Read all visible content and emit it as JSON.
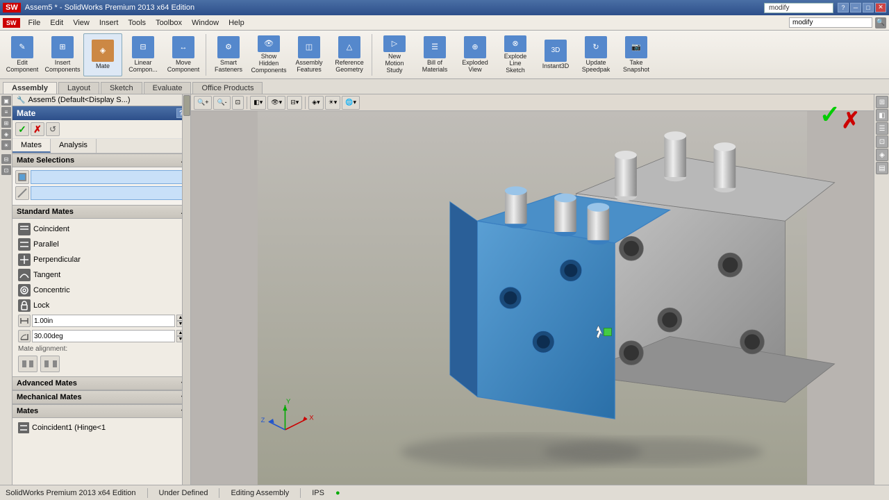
{
  "titlebar": {
    "title": "Assem5 * - SolidWorks Premium 2013 x64 Edition",
    "search_placeholder": "modify"
  },
  "menubar": {
    "items": [
      "File",
      "Edit",
      "View",
      "Insert",
      "Tools",
      "Toolbox",
      "Window",
      "Help"
    ],
    "logo": "SW"
  },
  "toolbar": {
    "buttons": [
      {
        "id": "edit-component",
        "label": "Edit\nComponent",
        "icon": "✎",
        "color": "#5588cc"
      },
      {
        "id": "insert-components",
        "label": "Insert\nComponents",
        "icon": "⊞",
        "color": "#5588cc"
      },
      {
        "id": "mate",
        "label": "Mate",
        "icon": "◈",
        "color": "#cc8844"
      },
      {
        "id": "linear-component",
        "label": "Linear\nCompon...",
        "icon": "⊟",
        "color": "#5588cc"
      },
      {
        "id": "move-component",
        "label": "Move\nComponent",
        "icon": "↔",
        "color": "#5588cc"
      },
      {
        "id": "smart-fasteners",
        "label": "Smart\nFasteners",
        "icon": "⚙",
        "color": "#5588cc"
      },
      {
        "id": "show-hidden",
        "label": "Show Hidden\nComponents",
        "icon": "👁",
        "color": "#5588cc"
      },
      {
        "id": "assembly-features",
        "label": "Assembly\nFeatures",
        "icon": "◫",
        "color": "#5588cc"
      },
      {
        "id": "reference-geometry",
        "label": "Reference\nGeometry",
        "icon": "△",
        "color": "#5588cc"
      },
      {
        "id": "new-motion-study",
        "label": "New\nMotion\nStudy",
        "icon": "▷",
        "color": "#5588cc"
      },
      {
        "id": "bill-of-materials",
        "label": "Bill of\nMaterials",
        "icon": "☰",
        "color": "#5588cc"
      },
      {
        "id": "exploded-view",
        "label": "Exploded\nView",
        "icon": "⊕",
        "color": "#5588cc"
      },
      {
        "id": "explode-line-sketch",
        "label": "Explode\nLine\nSketch",
        "icon": "⊗",
        "color": "#5588cc"
      },
      {
        "id": "instant3d",
        "label": "Instant3D",
        "icon": "3D",
        "color": "#5588cc"
      },
      {
        "id": "update-speedpak",
        "label": "Update\nSpeedpak",
        "icon": "↻",
        "color": "#5588cc"
      },
      {
        "id": "take-snapshot",
        "label": "Take\nSnapshot",
        "icon": "📷",
        "color": "#5588cc"
      }
    ]
  },
  "tabs": {
    "items": [
      "Assembly",
      "Layout",
      "Sketch",
      "Evaluate",
      "Office Products"
    ],
    "active": "Assembly"
  },
  "tree_header": {
    "text": "Assem5 (Default<Display S...)"
  },
  "mate_panel": {
    "title": "Mate",
    "help_label": "?",
    "confirm_label": "✓",
    "cancel_label": "✗",
    "reset_label": "↺",
    "tabs": [
      "Mates",
      "Analysis"
    ],
    "active_tab": "Mates",
    "selections_header": "Mate Selections",
    "selections_placeholder1": "",
    "selections_placeholder2": "",
    "standard_mates_header": "Standard Mates",
    "mates": [
      {
        "id": "coincident",
        "label": "Coincident",
        "icon": "//"
      },
      {
        "id": "parallel",
        "label": "Parallel",
        "icon": "//"
      },
      {
        "id": "perpendicular",
        "label": "Perpendicular",
        "icon": "⊥"
      },
      {
        "id": "tangent",
        "label": "Tangent",
        "icon": "⌒"
      },
      {
        "id": "concentric",
        "label": "Concentric",
        "icon": "◎"
      },
      {
        "id": "lock",
        "label": "Lock",
        "icon": "🔒"
      }
    ],
    "distance_value": "1.00in",
    "angle_value": "30.00deg",
    "alignment_label": "Mate alignment:",
    "advanced_mates_header": "Advanced Mates",
    "mechanical_mates_header": "Mechanical Mates",
    "mates_header": "Mates",
    "mates_list": [
      {
        "id": "coincident1",
        "label": "Coincident1 (Hinge<1",
        "icon": "//"
      }
    ]
  },
  "viewport": {
    "feature_tree": "Assem5 (Default<Display S...)",
    "check_icon": "✓",
    "x_icon": "✗"
  },
  "statusbar": {
    "edition": "SolidWorks Premium 2013 x64 Edition",
    "status": "Under Defined",
    "mode": "Editing Assembly",
    "units": "IPS",
    "indicator": "●"
  },
  "right_panel": {
    "buttons": [
      "≡",
      "⊞",
      "☰",
      "⊡",
      "◈",
      "▤"
    ]
  }
}
